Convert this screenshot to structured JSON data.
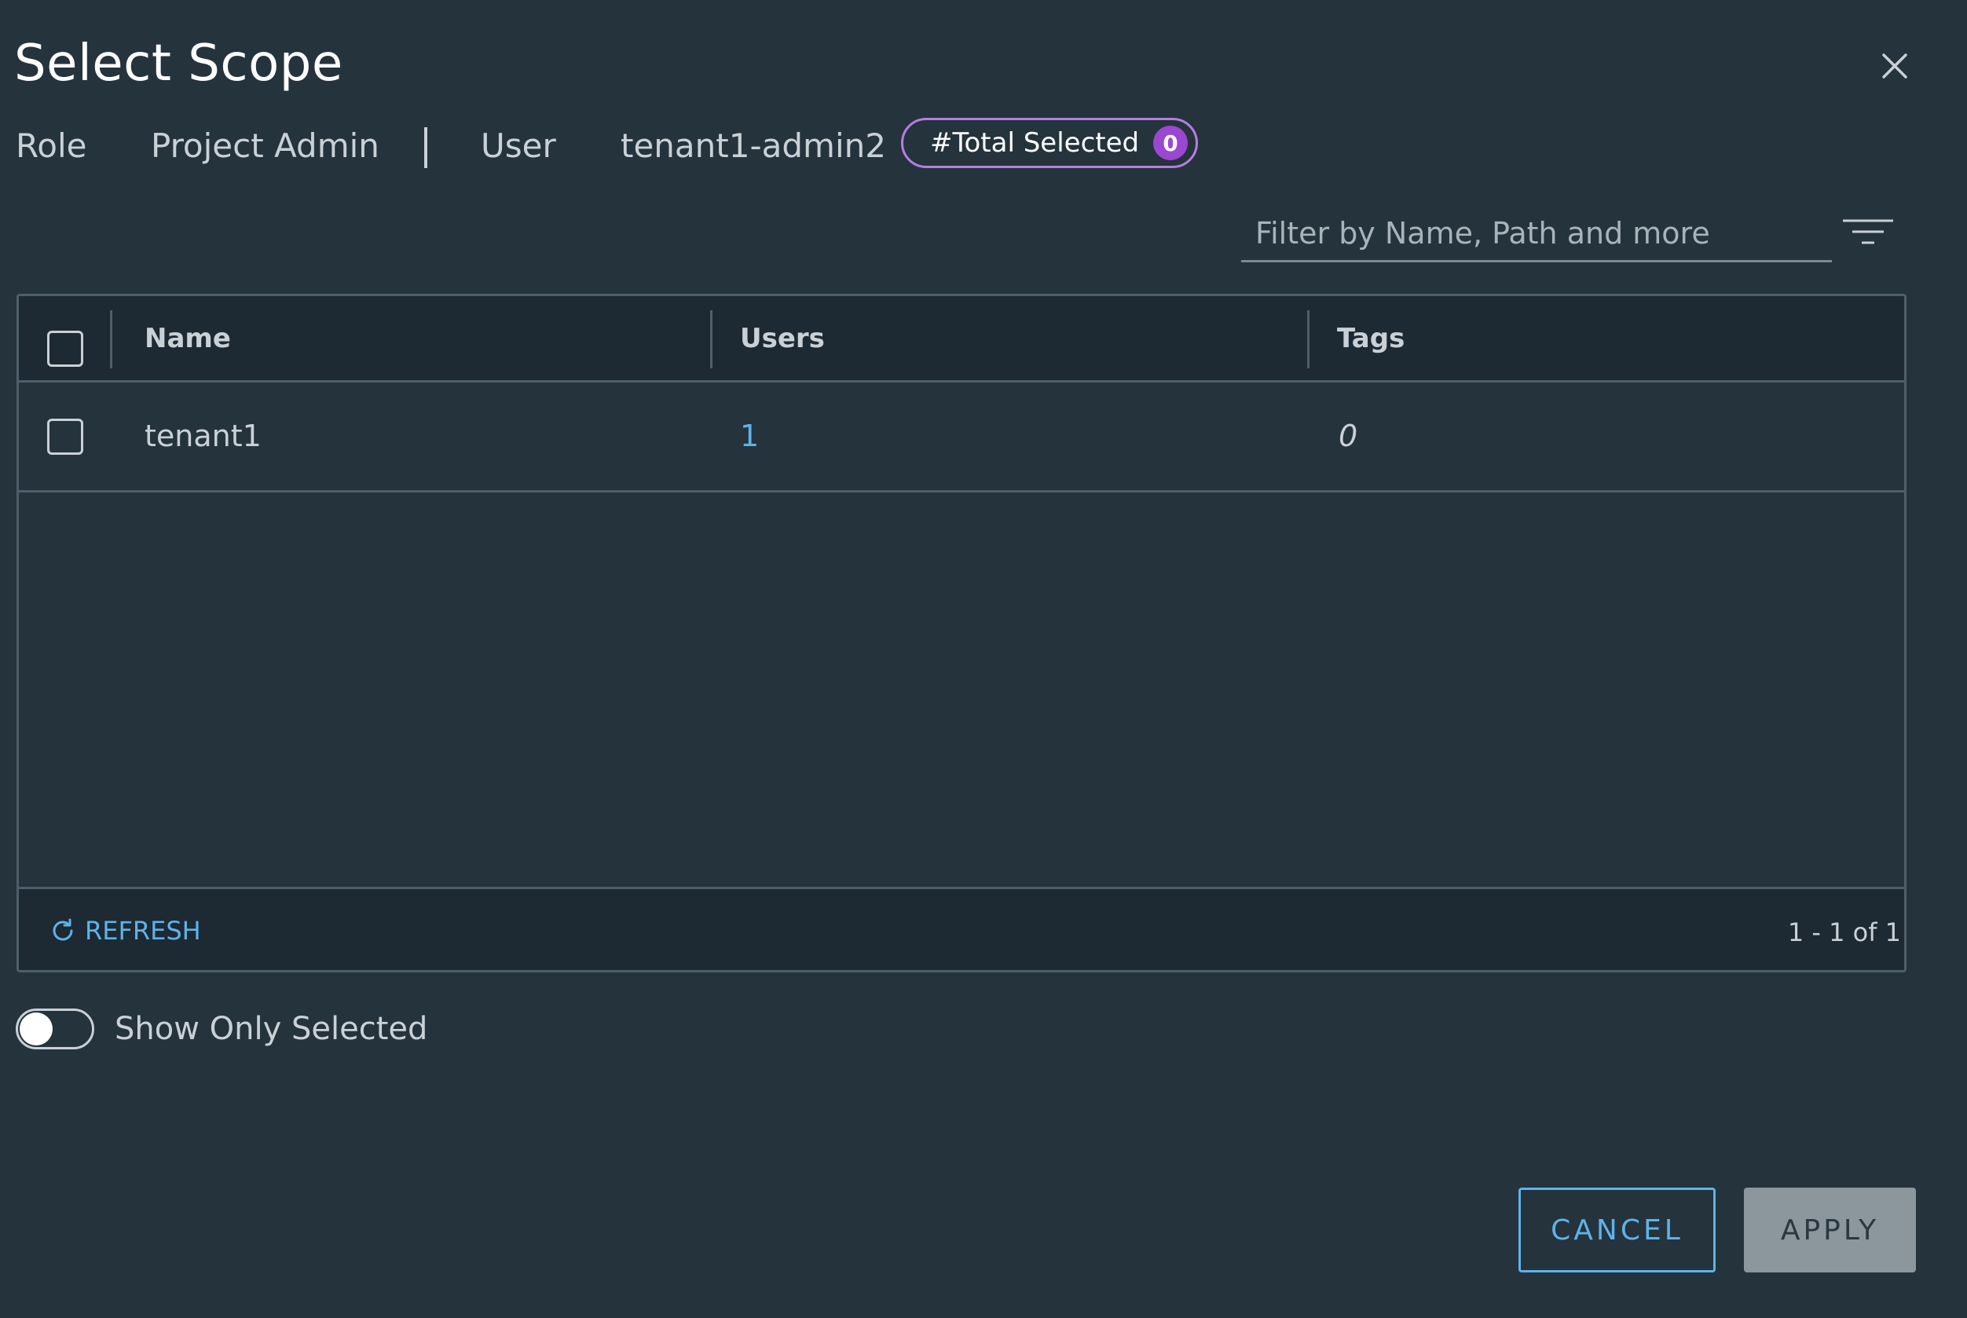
{
  "dialog": {
    "title": "Select Scope"
  },
  "context": {
    "role_label": "Role",
    "role_value": "Project Admin",
    "user_label": "User",
    "user_value": "tenant1-admin2",
    "total_selected_label": "#Total Selected",
    "total_selected_count": "0"
  },
  "filter": {
    "placeholder": "Filter by Name, Path and more",
    "value": ""
  },
  "table": {
    "columns": [
      "Name",
      "Users",
      "Tags"
    ],
    "rows": [
      {
        "name": "tenant1",
        "users": "1",
        "tags": "0"
      }
    ],
    "refresh_label": "REFRESH",
    "pagination": "1 - 1 of 1"
  },
  "toggle": {
    "label": "Show Only Selected",
    "on": false
  },
  "buttons": {
    "cancel": "CANCEL",
    "apply": "APPLY"
  },
  "colors": {
    "background": "#25333d",
    "accent": "#5eb3e8",
    "badge": "#9b47d1",
    "badge_border": "#b37fe0"
  },
  "icons": [
    "close-icon",
    "filter-icon",
    "refresh-icon"
  ]
}
